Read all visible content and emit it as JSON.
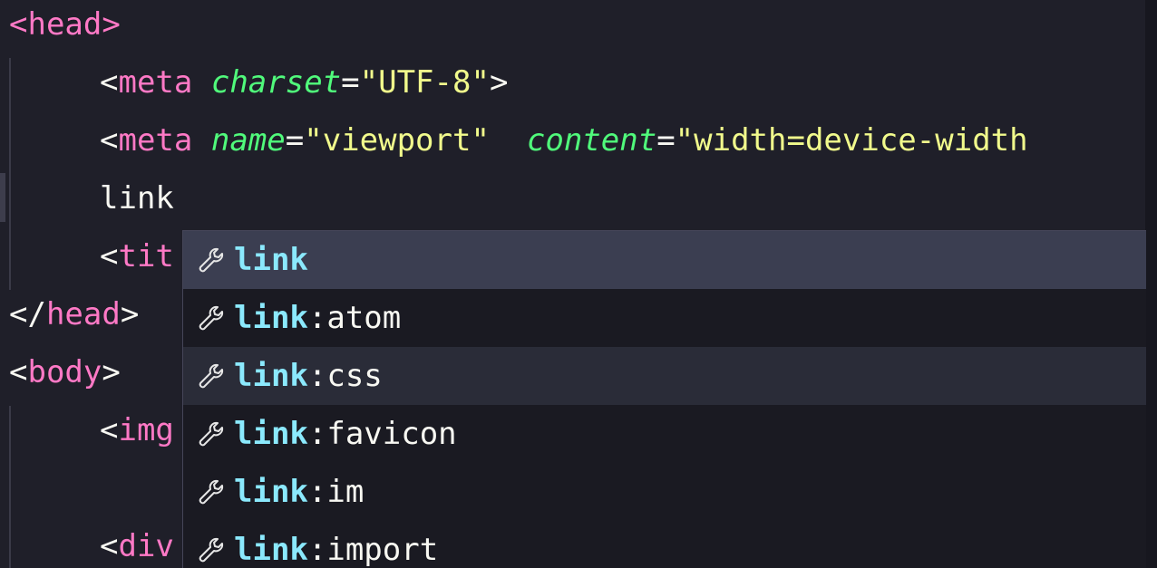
{
  "code": {
    "head_open": {
      "lt": "<",
      "tag": "head",
      "gt": ">"
    },
    "meta_charset": {
      "lt": "<",
      "tag": "meta",
      "attr": "charset",
      "eq": "=",
      "value": "\"UTF-8\"",
      "gt": ">"
    },
    "meta_viewport": {
      "lt": "<",
      "tag": "meta",
      "attr1": "name",
      "eq1": "=",
      "value1": "\"viewport\"",
      "attr2": "content",
      "eq2": "=",
      "value2": "\"width=device-width"
    },
    "typed_text": "link",
    "title_partial": {
      "lt": "<",
      "tag": "tit"
    },
    "head_close": {
      "lt": "</",
      "tag": "head",
      "gt": ">"
    },
    "body_open": {
      "lt": "<",
      "tag": "body",
      "gt": ">"
    },
    "img_partial": {
      "lt": "<",
      "tag": "img"
    },
    "div_partial": {
      "lt": "<",
      "tag": "div"
    }
  },
  "suggestions": {
    "icon": "wrench-icon",
    "items": [
      {
        "match": "link",
        "rest": ""
      },
      {
        "match": "link",
        "rest": ":atom"
      },
      {
        "match": "link",
        "rest": ":css"
      },
      {
        "match": "link",
        "rest": ":favicon"
      },
      {
        "match": "link",
        "rest": ":im"
      },
      {
        "match": "link",
        "rest": ":import"
      }
    ]
  },
  "colors": {
    "background": "#1f1f29",
    "tag": "#ff79c6",
    "attribute": "#50fa7b",
    "string": "#f1fa8c",
    "match": "#8be9fd",
    "selected_row": "#3b3e51"
  }
}
